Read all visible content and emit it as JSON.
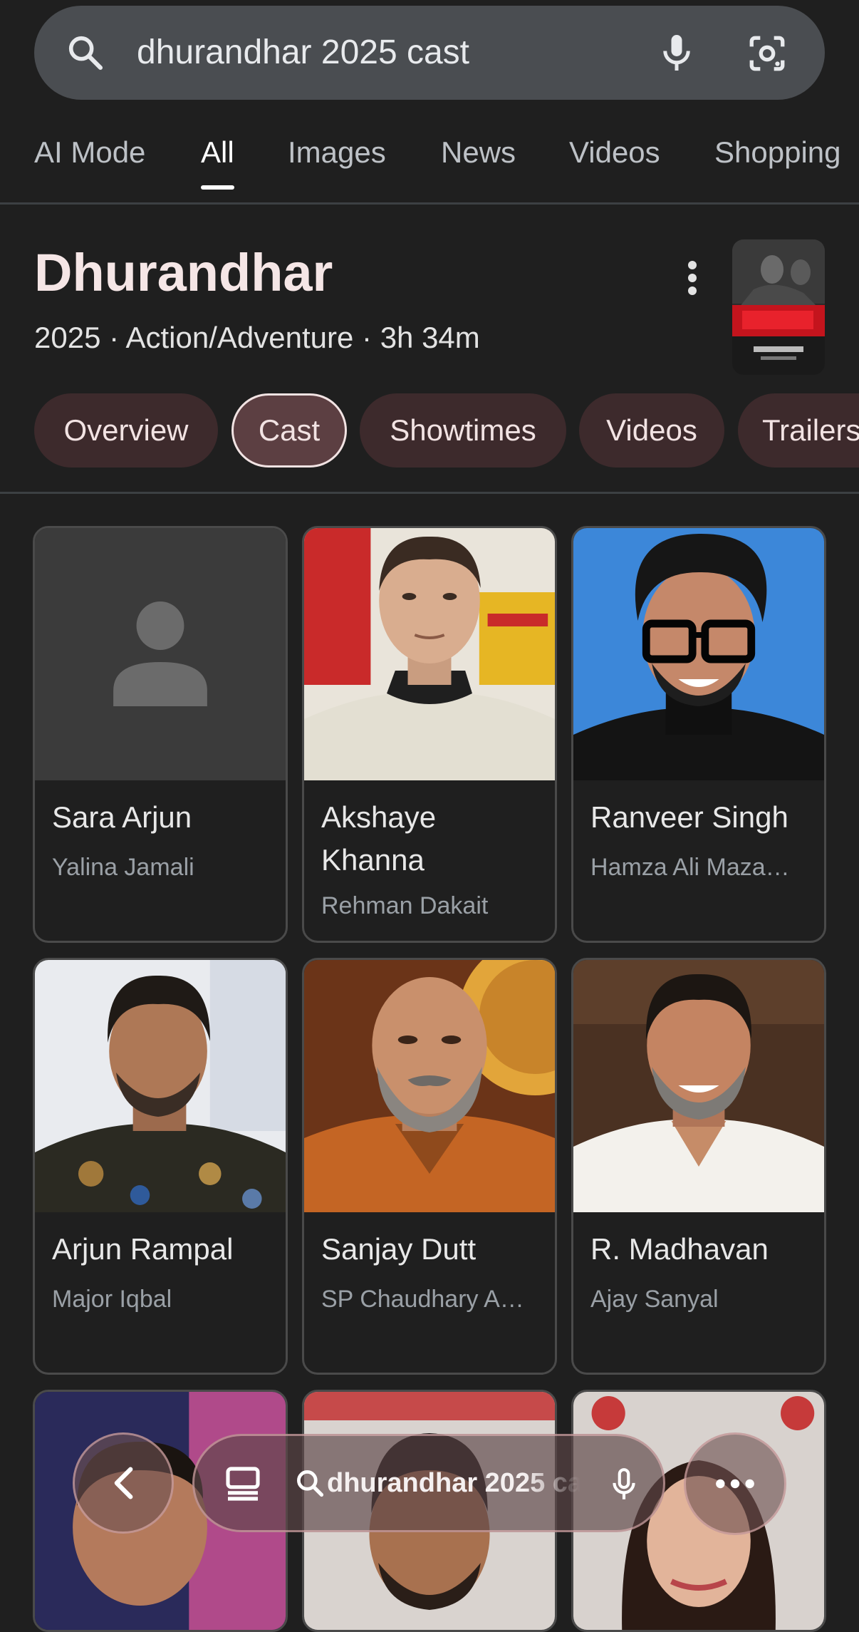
{
  "search": {
    "query": "dhurandhar 2025 cast",
    "icons": [
      "search-icon",
      "mic-icon",
      "google-lens-icon"
    ]
  },
  "tabs": [
    {
      "label": "AI Mode"
    },
    {
      "label": "All",
      "active": true
    },
    {
      "label": "Images"
    },
    {
      "label": "News"
    },
    {
      "label": "Videos"
    },
    {
      "label": "Shopping"
    }
  ],
  "movie": {
    "title": "Dhurandhar",
    "year": "2025",
    "separator": "·",
    "genre": "Action/Adventure",
    "runtime": "3h 34m"
  },
  "chips": [
    {
      "label": "Overview"
    },
    {
      "label": "Cast",
      "selected": true
    },
    {
      "label": "Showtimes"
    },
    {
      "label": "Videos"
    },
    {
      "label": "Trailers"
    }
  ],
  "cast": [
    {
      "name": "Sara Arjun",
      "role": "Yalina Jamali",
      "photo": "placeholder-person-icon"
    },
    {
      "name": "Akshaye Khanna",
      "role": "Rehman Dakait",
      "photo": "actor-photo"
    },
    {
      "name": "Ranveer Singh",
      "role": "Hamza Ali Maza…",
      "photo": "actor-photo"
    },
    {
      "name": "Arjun Rampal",
      "role": "Major Iqbal",
      "photo": "actor-photo"
    },
    {
      "name": "Sanjay Dutt",
      "role": "SP Chaudhary A…",
      "photo": "actor-photo"
    },
    {
      "name": "R. Madhavan",
      "role": "Ajay Sanyal",
      "photo": "actor-photo"
    }
  ],
  "bottom_bar": {
    "query": "dhurandhar 2025 ca",
    "icons": [
      "back-arrow-icon",
      "tabs-icon",
      "search-icon",
      "mic-icon",
      "more-horizontal-icon"
    ]
  },
  "colors": {
    "background": "#1f1f1f",
    "search_bar": "#4a4d51",
    "chip": "#3d2a2c",
    "chip_selected": "#5c3f42",
    "title": "#f5e6e6",
    "secondary_text": "#9aa0a6"
  }
}
